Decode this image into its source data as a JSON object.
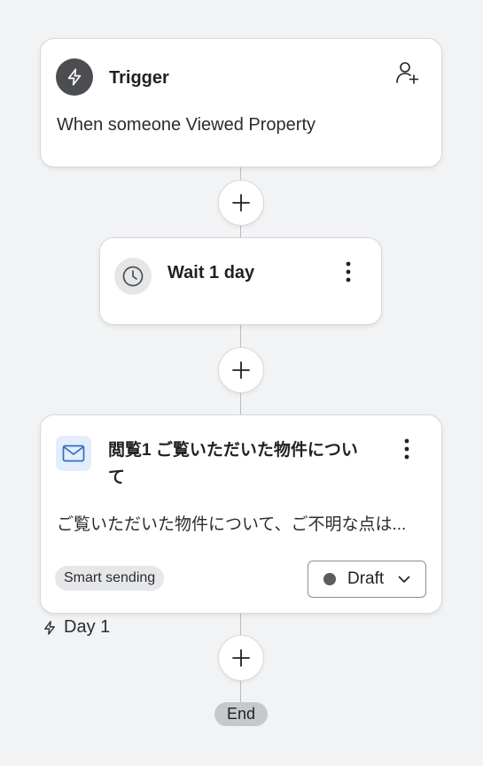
{
  "trigger": {
    "title": "Trigger",
    "description": "When someone Viewed Property"
  },
  "wait": {
    "title": "Wait 1 day"
  },
  "email": {
    "title_line1": "閲覧1 ご覧いただいた物件につい",
    "title_line2": "て",
    "preview": "ご覧いただいた物件について、ご不明な点は...",
    "tag": "Smart sending",
    "status": "Draft",
    "status_color": "#5a5c5f"
  },
  "day_label": "Day 1",
  "end_label": "End"
}
